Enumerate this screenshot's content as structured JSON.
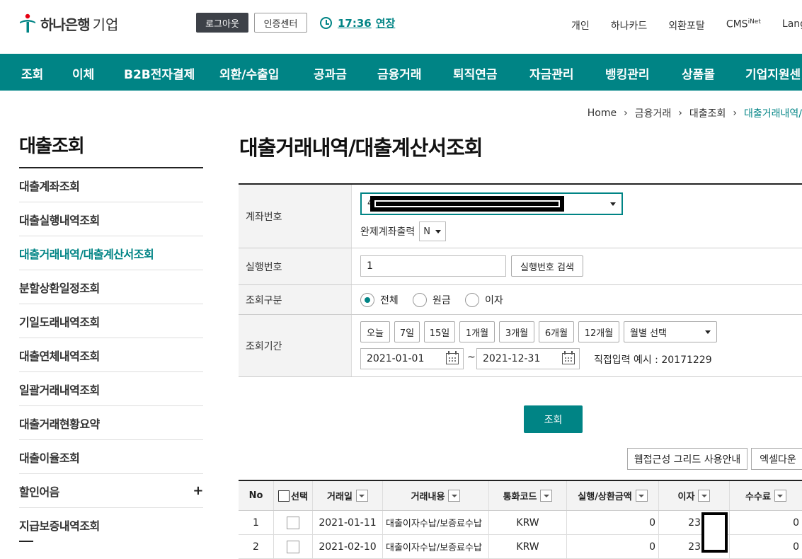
{
  "header": {
    "logo_text": "하나은행",
    "logo_sub": "기업",
    "logout_label": "로그아웃",
    "cert_label": "인증센터",
    "session_time": "17:36",
    "extend_label": "연장",
    "top_links": [
      "개인",
      "하나카드",
      "외환포탈",
      "CMS",
      "Lang"
    ],
    "cms_sup": "iNet"
  },
  "gnb": {
    "items": [
      "조회",
      "이체",
      "B2B전자결제",
      "외환/수출입",
      "공과금",
      "금융거래",
      "퇴직연금",
      "자금관리",
      "뱅킹관리",
      "상품몰",
      "기업지원센"
    ]
  },
  "breadcrumb": [
    "Home",
    "금융거래",
    "대출조회",
    "대출거래내역/"
  ],
  "sidebar": {
    "title": "대출조회",
    "items": [
      "대출계좌조회",
      "대출실행내역조회",
      "대출거래내역/대출계산서조회",
      "분할상환일정조회",
      "기일도래내역조회",
      "대출연체내역조회",
      "일괄거래내역조회",
      "대출거래현황요약",
      "대출이율조회",
      "할인어음",
      "지급보증내역조회"
    ],
    "plus": "+"
  },
  "page_title": "대출거래내역/대출계산서조회",
  "form": {
    "account_label": "계좌번호",
    "account_prefix": "4",
    "complete_label": "완제계좌출력",
    "complete_value": "N",
    "exec_label": "실행번호",
    "exec_value": "1",
    "exec_search": "실행번호 검색",
    "type_label": "조회구분",
    "type_options": [
      "전체",
      "원금",
      "이자"
    ],
    "period_label": "조회기간",
    "period_buttons": [
      "오늘",
      "7일",
      "15일",
      "1개월",
      "3개월",
      "6개월",
      "12개월"
    ],
    "month_select": "월별 선택",
    "date_from": "2021-01-01",
    "tilde": "~",
    "date_to": "2021-12-31",
    "hint": "직접입력 예시 : 20171229",
    "submit": "조회"
  },
  "actions": {
    "grid_guide": "웹접근성 그리드 사용안내",
    "excel": "엑셀다운"
  },
  "grid": {
    "headers": [
      "No",
      "선택",
      "거래일",
      "거래내용",
      "통화코드",
      "실행/상환금액",
      "이자",
      "수수료"
    ],
    "rows": [
      {
        "no": "1",
        "date": "2021-01-11",
        "desc": "대출이자수납/보증료수납",
        "currency": "KRW",
        "amount": "0",
        "interest": "23",
        "fee": "0"
      },
      {
        "no": "2",
        "date": "2021-02-10",
        "desc": "대출이자수납/보증료수납",
        "currency": "KRW",
        "amount": "0",
        "interest": "23",
        "fee": "0"
      }
    ]
  },
  "colors": {
    "brand": "#008485",
    "dark_button": "#3d4148"
  }
}
